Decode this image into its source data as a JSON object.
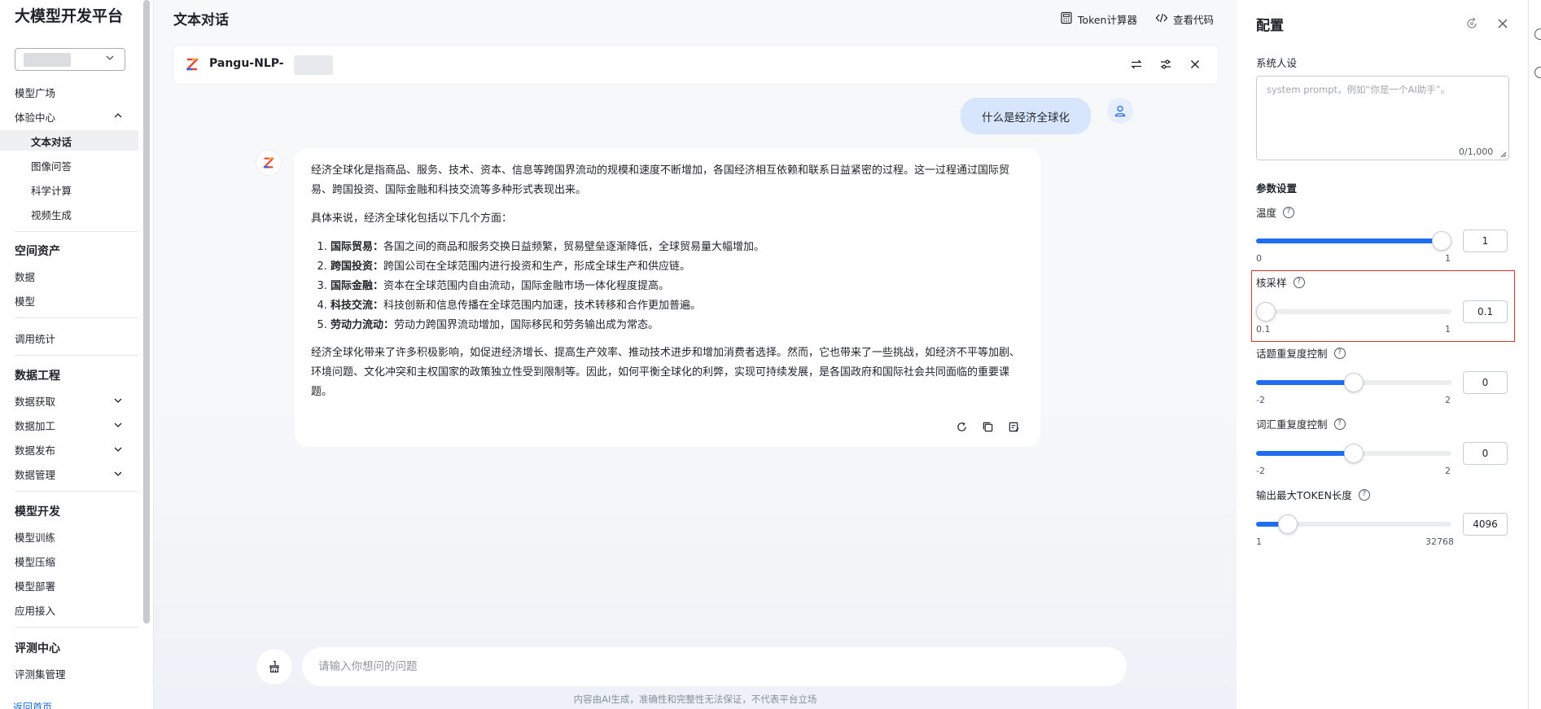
{
  "sidebar": {
    "app_title": "大模型开发平台",
    "nav": {
      "model_square": "模型广场",
      "experience_center": "体验中心",
      "text_chat": "文本对话",
      "image_qa": "图像问答",
      "science_compute": "科学计算",
      "video_gen": "视频生成",
      "space_assets": "空间资产",
      "data": "数据",
      "model": "模型",
      "call_stats": "调用统计",
      "data_engineering": "数据工程",
      "data_acquire": "数据获取",
      "data_process": "数据加工",
      "data_publish": "数据发布",
      "data_manage": "数据管理",
      "model_dev": "模型开发",
      "model_train": "模型训练",
      "model_compress": "模型压缩",
      "model_deploy": "模型部署",
      "app_access": "应用接入",
      "eval_center": "评测中心",
      "eval_set_manage": "评测集管理",
      "back_home": "返回首页"
    }
  },
  "main": {
    "page_title": "文本对话",
    "token_calc": "Token计算器",
    "view_code": "查看代码",
    "model_name": "Pangu-NLP-",
    "user_message": "什么是经济全球化",
    "answer": {
      "p1": "经济全球化是指商品、服务、技术、资本、信息等跨国界流动的规模和速度不断增加，各国经济相互依赖和联系日益紧密的过程。这一过程通过国际贸易、跨国投资、国际金融和科技交流等多种形式表现出来。",
      "p2": "具体来说，经济全球化包括以下几个方面：",
      "items": [
        {
          "title": "国际贸易：",
          "text": "各国之间的商品和服务交换日益频繁，贸易壁垒逐渐降低，全球贸易量大幅增加。"
        },
        {
          "title": "跨国投资：",
          "text": "跨国公司在全球范围内进行投资和生产，形成全球生产和供应链。"
        },
        {
          "title": "国际金融：",
          "text": "资本在全球范围内自由流动，国际金融市场一体化程度提高。"
        },
        {
          "title": "科技交流：",
          "text": "科技创新和信息传播在全球范围内加速，技术转移和合作更加普遍。"
        },
        {
          "title": "劳动力流动：",
          "text": "劳动力跨国界流动增加，国际移民和劳务输出成为常态。"
        }
      ],
      "p3": "经济全球化带来了许多积极影响，如促进经济增长、提高生产效率、推动技术进步和增加消费者选择。然而，它也带来了一些挑战，如经济不平等加剧、环境问题、文化冲突和主权国家的政策独立性受到限制等。因此，如何平衡全球化的利弊，实现可持续发展，是各国政府和国际社会共同面临的重要课题。"
    },
    "input_placeholder": "请输入你想问的问题",
    "disclaimer": "内容由AI生成，准确性和完整性无法保证，不代表平台立场"
  },
  "config": {
    "title": "配置",
    "system_persona_label": "系统人设",
    "system_prompt_placeholder": "system prompt，例如“你是一个AI助手”。",
    "system_prompt_count": "0/1,000",
    "params_label": "参数设置",
    "params": [
      {
        "label": "温度",
        "min_label": "0",
        "max_label": "1",
        "value": "1",
        "fraction": 1.0
      },
      {
        "label": "核采样",
        "min_label": "0.1",
        "max_label": "1",
        "value": "0.1",
        "fraction": 0.0
      },
      {
        "label": "话题重复度控制",
        "min_label": "-2",
        "max_label": "2",
        "value": "0",
        "fraction": 0.5
      },
      {
        "label": "词汇重复度控制",
        "min_label": "-2",
        "max_label": "2",
        "value": "0",
        "fraction": 0.5
      },
      {
        "label": "输出最大TOKEN长度",
        "min_label": "1",
        "max_label": "32768",
        "value": "4096",
        "fraction": 0.125
      }
    ]
  },
  "colors": {
    "accent": "#1f6df2",
    "highlight": "#e8312c",
    "user_bubble": "#d8e6fd"
  }
}
